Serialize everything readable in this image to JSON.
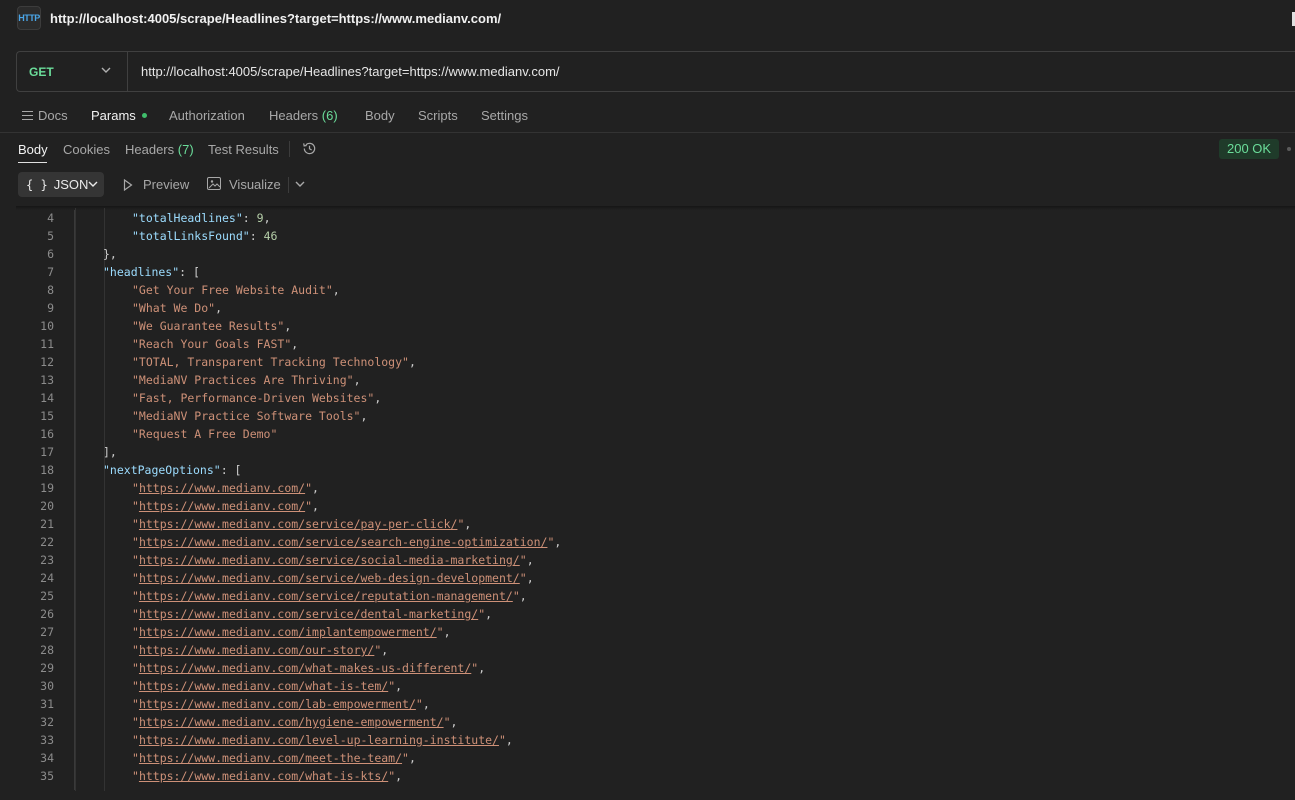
{
  "title_bar": {
    "icon": "HTTP",
    "url": "http://localhost:4005/scrape/Headlines?target=https://www.medianv.com/"
  },
  "request": {
    "method": "GET",
    "url": "http://localhost:4005/scrape/Headlines?target=https://www.medianv.com/"
  },
  "request_tabs": {
    "docs": "Docs",
    "params": "Params",
    "authorization": "Authorization",
    "headers": "Headers",
    "headers_count": "(6)",
    "body": "Body",
    "scripts": "Scripts",
    "settings": "Settings"
  },
  "response_tabs": {
    "body": "Body",
    "cookies": "Cookies",
    "headers": "Headers",
    "headers_count": "(7)",
    "test_results": "Test Results",
    "status": "200 OK"
  },
  "toolbar": {
    "format_braces": "{ }",
    "format": "JSON",
    "preview": "Preview",
    "visualize": "Visualize"
  },
  "colors": {
    "method": "#6bdd9a",
    "status_bg": "#1f3b2a",
    "json_key": "#9cdcfe",
    "json_string": "#ce9178",
    "json_number": "#b5cea8"
  },
  "code_lines": [
    {
      "n": "4",
      "indent": 2,
      "parts": [
        {
          "t": "key",
          "v": "\"totalHeadlines\""
        },
        {
          "t": "punc",
          "v": ": "
        },
        {
          "t": "num",
          "v": "9"
        },
        {
          "t": "punc",
          "v": ","
        }
      ]
    },
    {
      "n": "5",
      "indent": 2,
      "parts": [
        {
          "t": "key",
          "v": "\"totalLinksFound\""
        },
        {
          "t": "punc",
          "v": ": "
        },
        {
          "t": "num",
          "v": "46"
        }
      ]
    },
    {
      "n": "6",
      "indent": 1,
      "parts": [
        {
          "t": "punc",
          "v": "},"
        }
      ]
    },
    {
      "n": "7",
      "indent": 1,
      "parts": [
        {
          "t": "key",
          "v": "\"headlines\""
        },
        {
          "t": "punc",
          "v": ": ["
        }
      ]
    },
    {
      "n": "8",
      "indent": 2,
      "parts": [
        {
          "t": "str",
          "v": "\"Get Your Free Website Audit\""
        },
        {
          "t": "punc",
          "v": ","
        }
      ]
    },
    {
      "n": "9",
      "indent": 2,
      "parts": [
        {
          "t": "str",
          "v": "\"What We Do\""
        },
        {
          "t": "punc",
          "v": ","
        }
      ]
    },
    {
      "n": "10",
      "indent": 2,
      "parts": [
        {
          "t": "str",
          "v": "\"We Guarantee Results\""
        },
        {
          "t": "punc",
          "v": ","
        }
      ]
    },
    {
      "n": "11",
      "indent": 2,
      "parts": [
        {
          "t": "str",
          "v": "\"Reach Your Goals FAST\""
        },
        {
          "t": "punc",
          "v": ","
        }
      ]
    },
    {
      "n": "12",
      "indent": 2,
      "parts": [
        {
          "t": "str",
          "v": "\"TOTAL, Transparent Tracking Technology\""
        },
        {
          "t": "punc",
          "v": ","
        }
      ]
    },
    {
      "n": "13",
      "indent": 2,
      "parts": [
        {
          "t": "str",
          "v": "\"MediaNV Practices Are Thriving\""
        },
        {
          "t": "punc",
          "v": ","
        }
      ]
    },
    {
      "n": "14",
      "indent": 2,
      "parts": [
        {
          "t": "str",
          "v": "\"Fast, Performance-Driven Websites\""
        },
        {
          "t": "punc",
          "v": ","
        }
      ]
    },
    {
      "n": "15",
      "indent": 2,
      "parts": [
        {
          "t": "str",
          "v": "\"MediaNV Practice Software Tools\""
        },
        {
          "t": "punc",
          "v": ","
        }
      ]
    },
    {
      "n": "16",
      "indent": 2,
      "parts": [
        {
          "t": "str",
          "v": "\"Request A Free Demo\""
        }
      ]
    },
    {
      "n": "17",
      "indent": 1,
      "parts": [
        {
          "t": "punc",
          "v": "],"
        }
      ]
    },
    {
      "n": "18",
      "indent": 1,
      "parts": [
        {
          "t": "key",
          "v": "\"nextPageOptions\""
        },
        {
          "t": "punc",
          "v": ": ["
        }
      ]
    },
    {
      "n": "19",
      "indent": 2,
      "parts": [
        {
          "t": "str",
          "v": "\""
        },
        {
          "t": "link",
          "v": "https://www.medianv.com/"
        },
        {
          "t": "str",
          "v": "\""
        },
        {
          "t": "punc",
          "v": ","
        }
      ]
    },
    {
      "n": "20",
      "indent": 2,
      "parts": [
        {
          "t": "str",
          "v": "\""
        },
        {
          "t": "link",
          "v": "https://www.medianv.com/"
        },
        {
          "t": "str",
          "v": "\""
        },
        {
          "t": "punc",
          "v": ","
        }
      ]
    },
    {
      "n": "21",
      "indent": 2,
      "parts": [
        {
          "t": "str",
          "v": "\""
        },
        {
          "t": "link",
          "v": "https://www.medianv.com/service/pay-per-click/"
        },
        {
          "t": "str",
          "v": "\""
        },
        {
          "t": "punc",
          "v": ","
        }
      ]
    },
    {
      "n": "22",
      "indent": 2,
      "parts": [
        {
          "t": "str",
          "v": "\""
        },
        {
          "t": "link",
          "v": "https://www.medianv.com/service/search-engine-optimization/"
        },
        {
          "t": "str",
          "v": "\""
        },
        {
          "t": "punc",
          "v": ","
        }
      ]
    },
    {
      "n": "23",
      "indent": 2,
      "parts": [
        {
          "t": "str",
          "v": "\""
        },
        {
          "t": "link",
          "v": "https://www.medianv.com/service/social-media-marketing/"
        },
        {
          "t": "str",
          "v": "\""
        },
        {
          "t": "punc",
          "v": ","
        }
      ]
    },
    {
      "n": "24",
      "indent": 2,
      "parts": [
        {
          "t": "str",
          "v": "\""
        },
        {
          "t": "link",
          "v": "https://www.medianv.com/service/web-design-development/"
        },
        {
          "t": "str",
          "v": "\""
        },
        {
          "t": "punc",
          "v": ","
        }
      ]
    },
    {
      "n": "25",
      "indent": 2,
      "parts": [
        {
          "t": "str",
          "v": "\""
        },
        {
          "t": "link",
          "v": "https://www.medianv.com/service/reputation-management/"
        },
        {
          "t": "str",
          "v": "\""
        },
        {
          "t": "punc",
          "v": ","
        }
      ]
    },
    {
      "n": "26",
      "indent": 2,
      "parts": [
        {
          "t": "str",
          "v": "\""
        },
        {
          "t": "link",
          "v": "https://www.medianv.com/service/dental-marketing/"
        },
        {
          "t": "str",
          "v": "\""
        },
        {
          "t": "punc",
          "v": ","
        }
      ]
    },
    {
      "n": "27",
      "indent": 2,
      "parts": [
        {
          "t": "str",
          "v": "\""
        },
        {
          "t": "link",
          "v": "https://www.medianv.com/implantempowerment/"
        },
        {
          "t": "str",
          "v": "\""
        },
        {
          "t": "punc",
          "v": ","
        }
      ]
    },
    {
      "n": "28",
      "indent": 2,
      "parts": [
        {
          "t": "str",
          "v": "\""
        },
        {
          "t": "link",
          "v": "https://www.medianv.com/our-story/"
        },
        {
          "t": "str",
          "v": "\""
        },
        {
          "t": "punc",
          "v": ","
        }
      ]
    },
    {
      "n": "29",
      "indent": 2,
      "parts": [
        {
          "t": "str",
          "v": "\""
        },
        {
          "t": "link",
          "v": "https://www.medianv.com/what-makes-us-different/"
        },
        {
          "t": "str",
          "v": "\""
        },
        {
          "t": "punc",
          "v": ","
        }
      ]
    },
    {
      "n": "30",
      "indent": 2,
      "parts": [
        {
          "t": "str",
          "v": "\""
        },
        {
          "t": "link",
          "v": "https://www.medianv.com/what-is-tem/"
        },
        {
          "t": "str",
          "v": "\""
        },
        {
          "t": "punc",
          "v": ","
        }
      ]
    },
    {
      "n": "31",
      "indent": 2,
      "parts": [
        {
          "t": "str",
          "v": "\""
        },
        {
          "t": "link",
          "v": "https://www.medianv.com/lab-empowerment/"
        },
        {
          "t": "str",
          "v": "\""
        },
        {
          "t": "punc",
          "v": ","
        }
      ]
    },
    {
      "n": "32",
      "indent": 2,
      "parts": [
        {
          "t": "str",
          "v": "\""
        },
        {
          "t": "link",
          "v": "https://www.medianv.com/hygiene-empowerment/"
        },
        {
          "t": "str",
          "v": "\""
        },
        {
          "t": "punc",
          "v": ","
        }
      ]
    },
    {
      "n": "33",
      "indent": 2,
      "parts": [
        {
          "t": "str",
          "v": "\""
        },
        {
          "t": "link",
          "v": "https://www.medianv.com/level-up-learning-institute/"
        },
        {
          "t": "str",
          "v": "\""
        },
        {
          "t": "punc",
          "v": ","
        }
      ]
    },
    {
      "n": "34",
      "indent": 2,
      "parts": [
        {
          "t": "str",
          "v": "\""
        },
        {
          "t": "link",
          "v": "https://www.medianv.com/meet-the-team/"
        },
        {
          "t": "str",
          "v": "\""
        },
        {
          "t": "punc",
          "v": ","
        }
      ]
    },
    {
      "n": "35",
      "indent": 2,
      "parts": [
        {
          "t": "str",
          "v": "\""
        },
        {
          "t": "link",
          "v": "https://www.medianv.com/what-is-kts/"
        },
        {
          "t": "str",
          "v": "\""
        },
        {
          "t": "punc",
          "v": ","
        }
      ]
    }
  ]
}
